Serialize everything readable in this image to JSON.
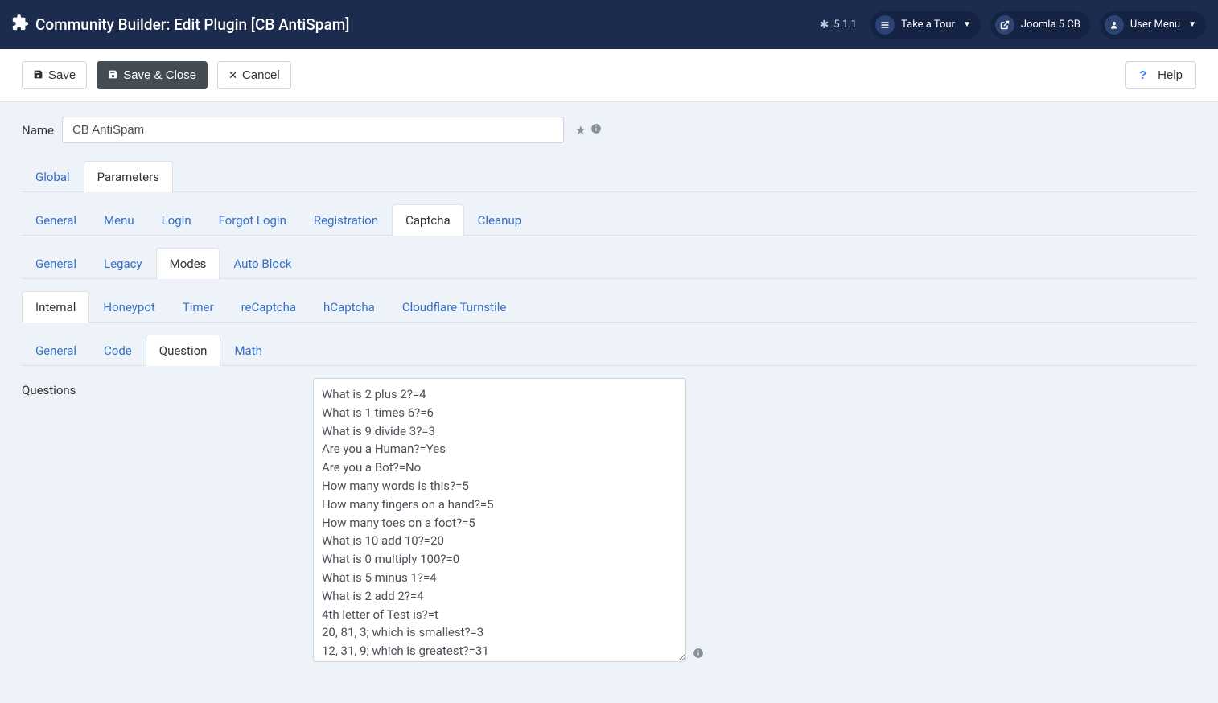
{
  "header": {
    "title": "Community Builder: Edit Plugin [CB AntiSpam]",
    "version": "5.1.1",
    "take_tour": "Take a Tour",
    "frontend": "Joomla 5 CB",
    "user_menu": "User Menu"
  },
  "toolbar": {
    "save": "Save",
    "save_close": "Save & Close",
    "cancel": "Cancel",
    "help": "Help"
  },
  "form": {
    "name_label": "Name",
    "name_value": "CB AntiSpam"
  },
  "tabs_level1": [
    {
      "label": "Global",
      "active": false
    },
    {
      "label": "Parameters",
      "active": true
    }
  ],
  "tabs_level2": [
    {
      "label": "General",
      "active": false
    },
    {
      "label": "Menu",
      "active": false
    },
    {
      "label": "Login",
      "active": false
    },
    {
      "label": "Forgot Login",
      "active": false
    },
    {
      "label": "Registration",
      "active": false
    },
    {
      "label": "Captcha",
      "active": true
    },
    {
      "label": "Cleanup",
      "active": false
    }
  ],
  "tabs_level3": [
    {
      "label": "General",
      "active": false
    },
    {
      "label": "Legacy",
      "active": false
    },
    {
      "label": "Modes",
      "active": true
    },
    {
      "label": "Auto Block",
      "active": false
    }
  ],
  "tabs_level4": [
    {
      "label": "Internal",
      "active": true
    },
    {
      "label": "Honeypot",
      "active": false
    },
    {
      "label": "Timer",
      "active": false
    },
    {
      "label": "reCaptcha",
      "active": false
    },
    {
      "label": "hCaptcha",
      "active": false
    },
    {
      "label": "Cloudflare Turnstile",
      "active": false
    }
  ],
  "tabs_level5": [
    {
      "label": "General",
      "active": false
    },
    {
      "label": "Code",
      "active": false
    },
    {
      "label": "Question",
      "active": true
    },
    {
      "label": "Math",
      "active": false
    }
  ],
  "questions": {
    "label": "Questions",
    "value": "What is 2 plus 2?=4\nWhat is 1 times 6?=6\nWhat is 9 divide 3?=3\nAre you a Human?=Yes\nAre you a Bot?=No\nHow many words is this?=5\nHow many fingers on a hand?=5\nHow many toes on a foot?=5\nWhat is 10 add 10?=20\nWhat is 0 multiply 100?=0\nWhat is 5 minus 1?=4\nWhat is 2 add 2?=4\n4th letter of Test is?=t\n20, 81, 3; which is smallest?=3\n12, 31, 9; which is greatest?=31"
  }
}
